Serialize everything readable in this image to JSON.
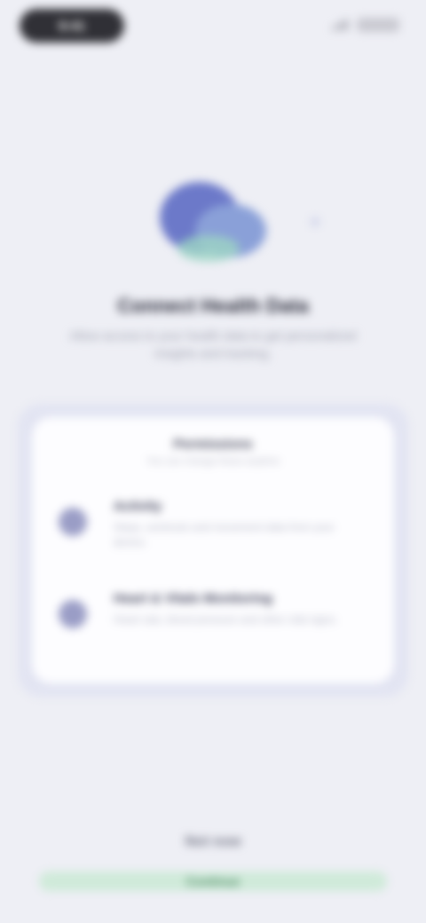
{
  "status_bar": {
    "time": "9:41"
  },
  "hero": {
    "title": "Connect Health Data",
    "subtitle": "Allow access to your health data to get personalized insights and tracking."
  },
  "card": {
    "header": "Permissions",
    "subheader": "You can change these anytime",
    "items": [
      {
        "icon": "activity-icon",
        "title": "Activity",
        "description": "Steps, workouts and movement data from your device."
      },
      {
        "icon": "heart-icon",
        "title": "Heart & Vitals Monitoring",
        "description": "Heart rate, blood pressure and other vital signs."
      }
    ]
  },
  "footer": {
    "secondary_label": "Not now",
    "primary_label": "Continue"
  },
  "colors": {
    "background": "#eeeff5",
    "accent": "#6c79c9",
    "button": "#cfead9"
  }
}
